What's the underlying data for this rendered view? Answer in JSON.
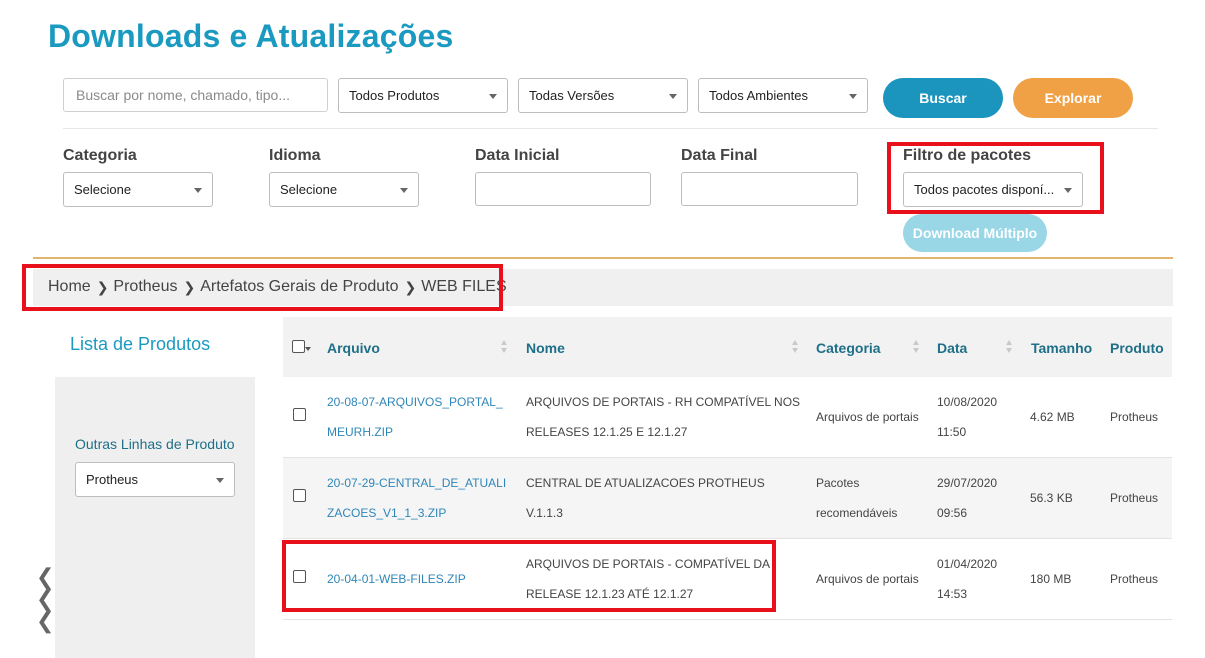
{
  "header": {
    "title": "Downloads e Atualizações"
  },
  "search": {
    "placeholder": "Buscar por nome, chamado, tipo..."
  },
  "filters_top": {
    "produto": "Todos Produtos",
    "versao": "Todas Versões",
    "ambiente": "Todos Ambientes",
    "buscar_label": "Buscar",
    "explorar_label": "Explorar"
  },
  "filters_bottom": {
    "categoria": {
      "label": "Categoria",
      "value": "Selecione"
    },
    "idioma": {
      "label": "Idioma",
      "value": "Selecione"
    },
    "data_inicial": {
      "label": "Data Inicial"
    },
    "data_final": {
      "label": "Data Final"
    },
    "pacotes": {
      "label": "Filtro de pacotes",
      "value": "Todos pacotes disponí..."
    },
    "download_multiplo_label": "Download Múltiplo"
  },
  "breadcrumb": [
    "Home",
    "Protheus",
    "Artefatos Gerais de Produto",
    "WEB FILES"
  ],
  "sidebar": {
    "title": "Lista de Produtos",
    "outras_label": "Outras Linhas de Produto",
    "produto_value": "Protheus"
  },
  "table": {
    "columns": [
      "Arquivo",
      "Nome",
      "Categoria",
      "Data",
      "Tamanho",
      "Produto"
    ],
    "rows": [
      {
        "arquivo": [
          "20-08-07-ARQUIVOS_PORTAL_",
          "MEURH.ZIP"
        ],
        "nome": [
          "ARQUIVOS DE PORTAIS - RH COMPATÍVEL NOS",
          "RELEASES 12.1.25 E 12.1.27"
        ],
        "categoria": [
          "Arquivos de portais"
        ],
        "data": [
          "10/08/2020",
          "11:50"
        ],
        "tamanho": "4.62 MB",
        "produto": "Protheus"
      },
      {
        "arquivo": [
          "20-07-29-CENTRAL_DE_ATUALI",
          "ZACOES_V1_1_3.ZIP"
        ],
        "nome": [
          "CENTRAL DE ATUALIZACOES PROTHEUS",
          "V.1.1.3"
        ],
        "categoria": [
          "Pacotes",
          "recomendáveis"
        ],
        "data": [
          "29/07/2020",
          "09:56"
        ],
        "tamanho": "56.3 KB",
        "produto": "Protheus"
      },
      {
        "arquivo": [
          "20-04-01-WEB-FILES.ZIP"
        ],
        "nome": [
          "ARQUIVOS DE PORTAIS - COMPATÍVEL DA",
          "RELEASE 12.1.23 ATÉ 12.1.27"
        ],
        "categoria": [
          "Arquivos de portais"
        ],
        "data": [
          "01/04/2020",
          "14:53"
        ],
        "tamanho": "180 MB",
        "produto": "Protheus"
      }
    ]
  },
  "pager": {
    "arrows": [
      "❮",
      "❮",
      "❮"
    ]
  },
  "colors": {
    "title": "#1a9ac0",
    "buscar": "#1b95bd",
    "explorar": "#f0a145",
    "download": "#99d6e6",
    "highlight": "#e8101b",
    "divider": "#e2b46e"
  }
}
